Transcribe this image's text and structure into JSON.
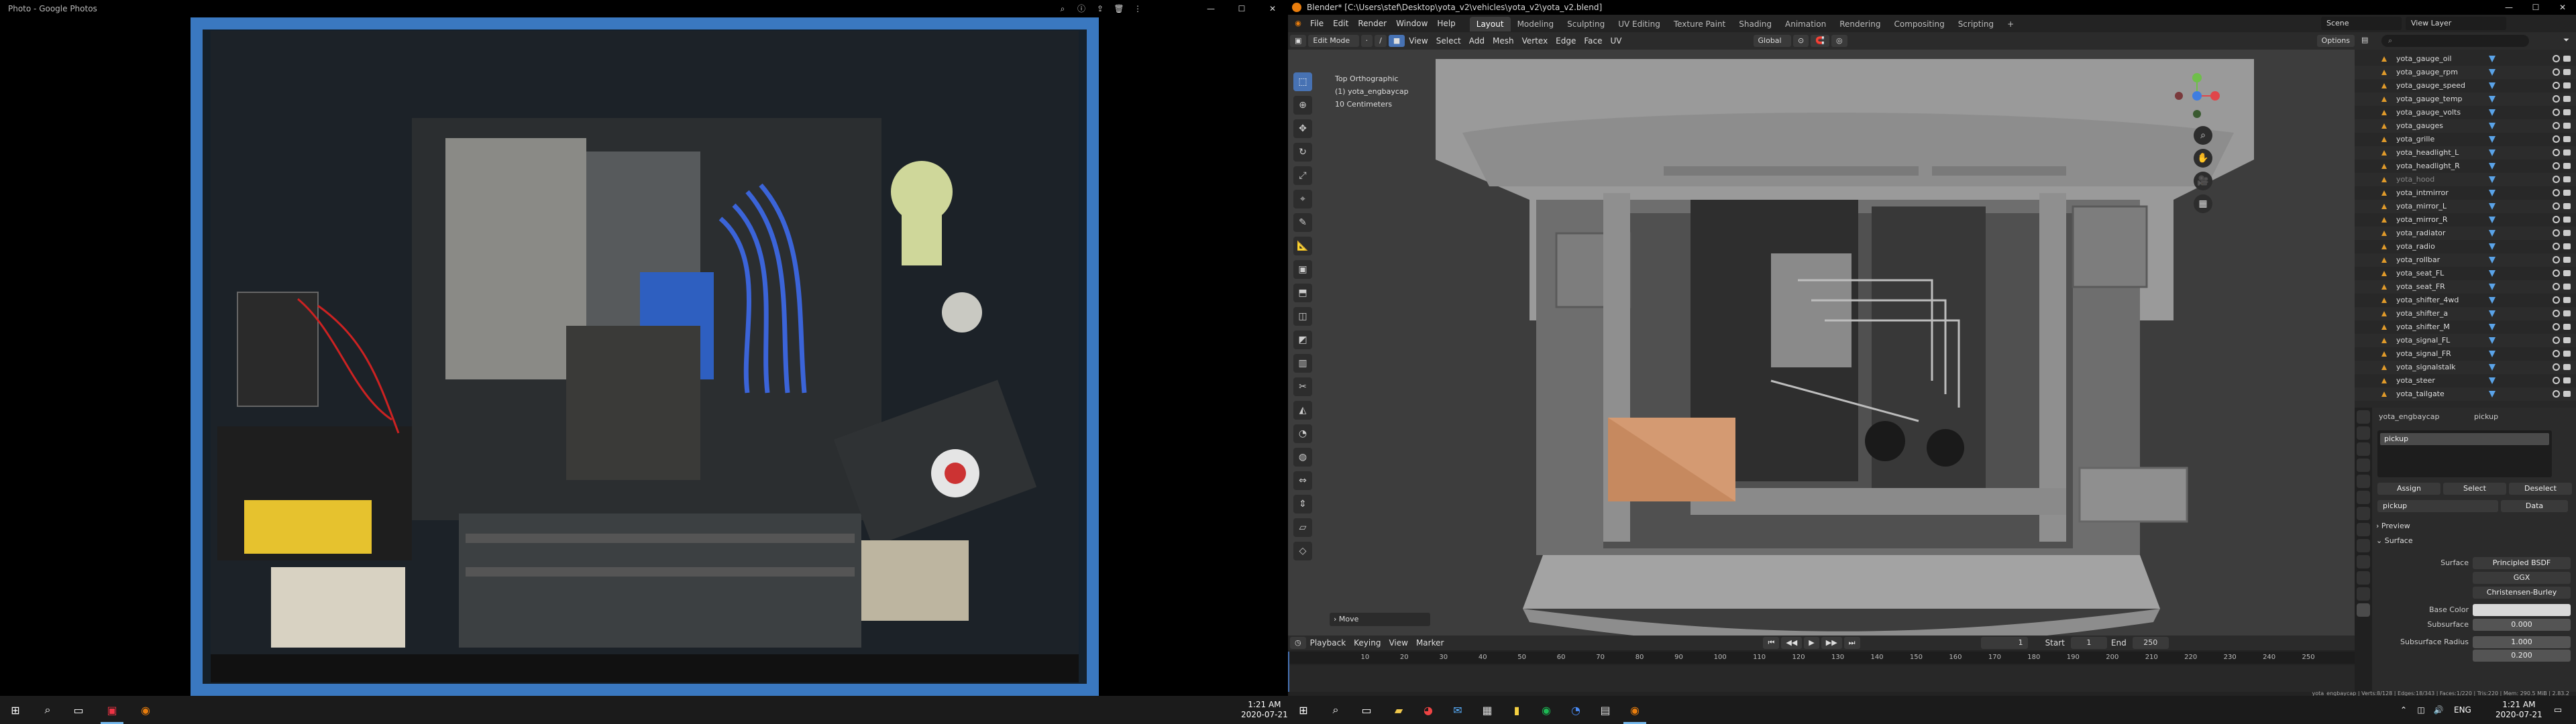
{
  "photos": {
    "title": "Photo - Google Photos"
  },
  "left_taskbar": {
    "time": "1:21 AM",
    "date": "2020-07-21"
  },
  "blender": {
    "title": "Blender* [C:\\Users\\stef\\Desktop\\yota_v2\\vehicles\\yota_v2\\yota_v2.blend]",
    "menu": [
      "File",
      "Edit",
      "Render",
      "Window",
      "Help"
    ],
    "workspaces": [
      "Layout",
      "Modeling",
      "Sculpting",
      "UV Editing",
      "Texture Paint",
      "Shading",
      "Animation",
      "Rendering",
      "Compositing",
      "Scripting"
    ],
    "active_workspace": "Layout",
    "scene": "Scene",
    "view_layer": "View Layer",
    "viewport": {
      "mode": "Edit Mode",
      "header_menus": [
        "View",
        "Select",
        "Add",
        "Mesh",
        "Vertex",
        "Edge",
        "Face",
        "UV"
      ],
      "orientation": "Global",
      "options": "Options",
      "view_name": "Top Orthographic",
      "object_name": "(1) yota_engbaycap",
      "scale": "10 Centimeters",
      "last_op": "Move"
    },
    "timeline": {
      "menus": [
        "Playback",
        "Keying",
        "View",
        "Marker"
      ],
      "current_frame": "1",
      "start_label": "Start",
      "start": "1",
      "end_label": "End",
      "end": "250",
      "ticks": [
        "10",
        "20",
        "30",
        "40",
        "50",
        "60",
        "70",
        "80",
        "90",
        "100",
        "110",
        "120",
        "130",
        "140",
        "150",
        "160",
        "170",
        "180",
        "190",
        "200",
        "210",
        "220",
        "230",
        "240",
        "250"
      ]
    },
    "outliner": {
      "items": [
        {
          "name": "yota_gauge_oil",
          "dim": false
        },
        {
          "name": "yota_gauge_rpm",
          "dim": false
        },
        {
          "name": "yota_gauge_speed",
          "dim": false
        },
        {
          "name": "yota_gauge_temp",
          "dim": false
        },
        {
          "name": "yota_gauge_volts",
          "dim": false
        },
        {
          "name": "yota_gauges",
          "dim": false
        },
        {
          "name": "yota_grille",
          "dim": false
        },
        {
          "name": "yota_headlight_L",
          "dim": false
        },
        {
          "name": "yota_headlight_R",
          "dim": false
        },
        {
          "name": "yota_hood",
          "dim": true
        },
        {
          "name": "yota_intmirror",
          "dim": false
        },
        {
          "name": "yota_mirror_L",
          "dim": false
        },
        {
          "name": "yota_mirror_R",
          "dim": false
        },
        {
          "name": "yota_radiator",
          "dim": false
        },
        {
          "name": "yota_radio",
          "dim": false
        },
        {
          "name": "yota_rollbar",
          "dim": false
        },
        {
          "name": "yota_seat_FL",
          "dim": false
        },
        {
          "name": "yota_seat_FR",
          "dim": false
        },
        {
          "name": "yota_shifter_4wd",
          "dim": false
        },
        {
          "name": "yota_shifter_a",
          "dim": false
        },
        {
          "name": "yota_shifter_M",
          "dim": false
        },
        {
          "name": "yota_signal_FL",
          "dim": false
        },
        {
          "name": "yota_signal_FR",
          "dim": false
        },
        {
          "name": "yota_signalstalk",
          "dim": false
        },
        {
          "name": "yota_steer",
          "dim": false
        },
        {
          "name": "yota_tailgate",
          "dim": false
        }
      ]
    },
    "properties": {
      "object": "yota_engbaycap",
      "material_slot_owner": "pickup",
      "slot": "pickup",
      "assign": "Assign",
      "select": "Select",
      "deselect": "Deselect",
      "material": "pickup",
      "data": "Data",
      "preview": "Preview",
      "surface_section": "Surface",
      "surface_label": "Surface",
      "surface_value": "Principled BSDF",
      "ggx": "GGX",
      "christensen": "Christensen-Burley",
      "base_color_label": "Base Color",
      "subsurface_label": "Subsurface",
      "subsurface_value": "0.000",
      "subsurface_radius_label": "Subsurface Radius",
      "subsurface_radius_1": "1.000",
      "subsurface_radius_2": "0.200"
    },
    "status": "yota_engbaycap | Verts:8/128 | Edges:18/343 | Faces:1/220 | Tris:220 | Mem: 290.5 MiB | 2.83.2"
  },
  "right_taskbar": {
    "lang": "ENG",
    "time": "1:21 AM",
    "date": "2020-07-21"
  },
  "colors": {
    "accent": "#4772b3",
    "orange": "#e09a2a",
    "selected_face": "#d49a72"
  }
}
